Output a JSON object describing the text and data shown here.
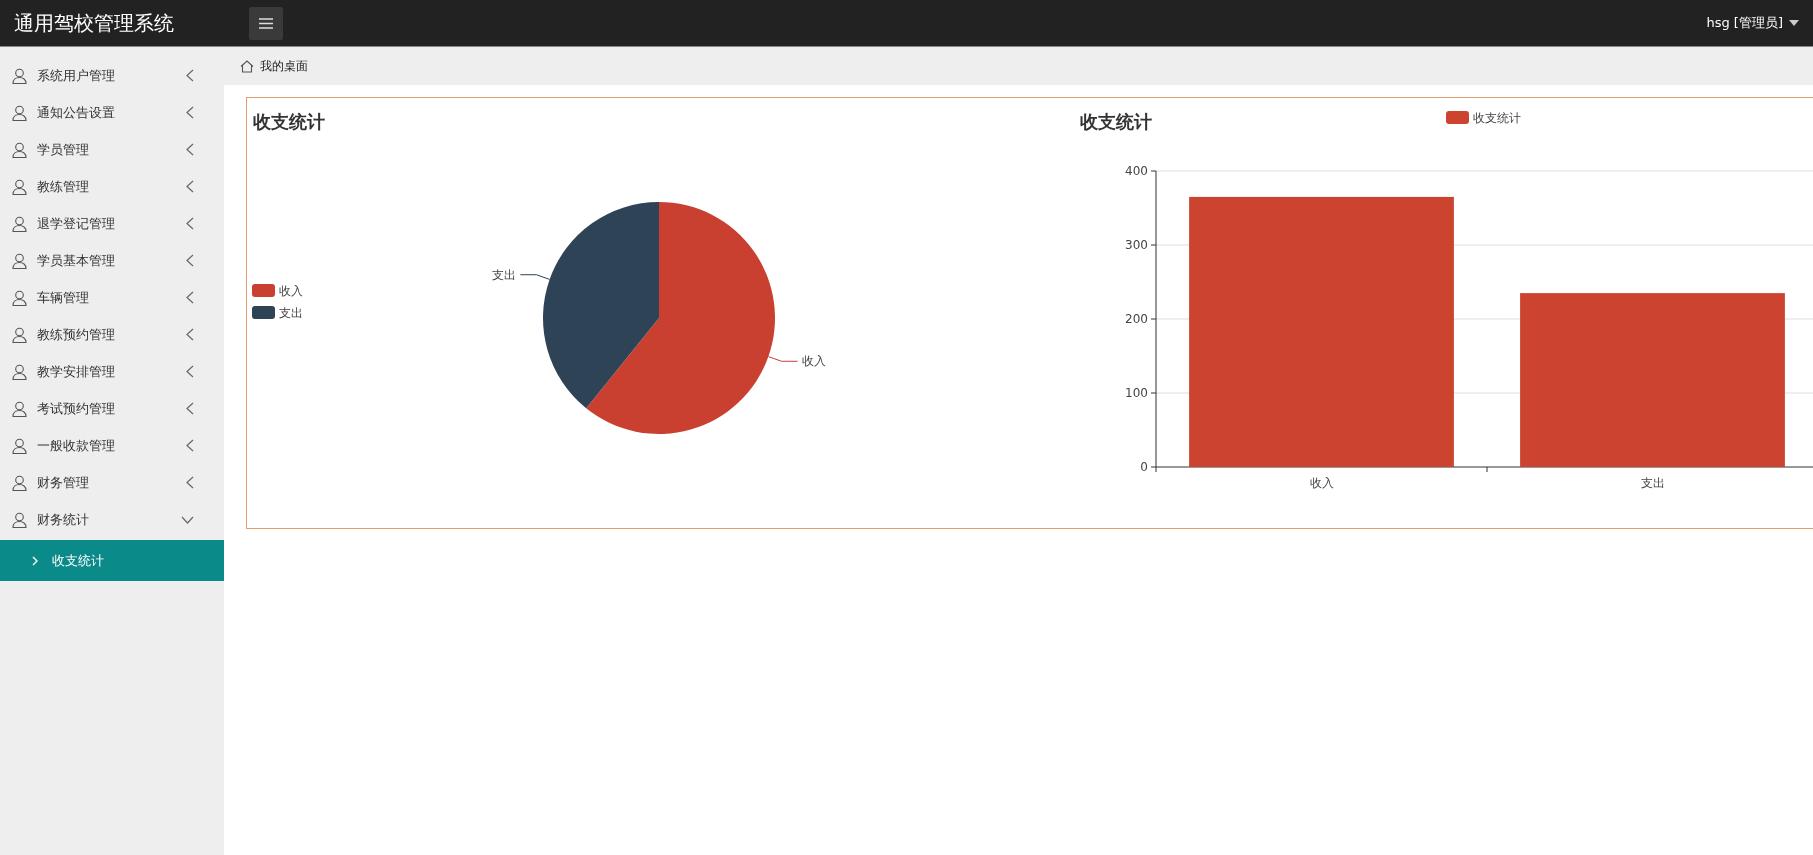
{
  "header": {
    "title": "通用驾校管理系统",
    "user": "hsg [管理员]"
  },
  "sidebar": {
    "items": [
      {
        "label": "系统用户管理",
        "expanded": false
      },
      {
        "label": "通知公告设置",
        "expanded": false
      },
      {
        "label": "学员管理",
        "expanded": false
      },
      {
        "label": "教练管理",
        "expanded": false
      },
      {
        "label": "退学登记管理",
        "expanded": false
      },
      {
        "label": "学员基本管理",
        "expanded": false
      },
      {
        "label": "车辆管理",
        "expanded": false
      },
      {
        "label": "教练预约管理",
        "expanded": false
      },
      {
        "label": "教学安排管理",
        "expanded": false
      },
      {
        "label": "考试预约管理",
        "expanded": false
      },
      {
        "label": "一般收款管理",
        "expanded": false
      },
      {
        "label": "财务管理",
        "expanded": false
      },
      {
        "label": "财务统计",
        "expanded": true,
        "children": [
          {
            "label": "收支统计",
            "selected": true
          }
        ]
      }
    ]
  },
  "breadcrumb": "我的桌面",
  "charts": [
    {
      "chart_data": {
        "type": "pie",
        "title": "收支统计",
        "categories": [
          "收入",
          "支出"
        ],
        "series": [
          {
            "values": [
              60.8,
              39.2
            ]
          }
        ],
        "legend": true
      }
    },
    {
      "chart_data": {
        "type": "bar",
        "title": "收支统计",
        "categories": [
          "收入",
          "支出"
        ],
        "series": [
          {
            "name": "收支统计",
            "color": "#cc4430",
            "values": [
              365,
              235
            ]
          }
        ],
        "ylim": [
          0,
          400
        ],
        "yticks": [
          0,
          100,
          200,
          300,
          400
        ],
        "legend": true,
        "grid": true
      }
    }
  ]
}
